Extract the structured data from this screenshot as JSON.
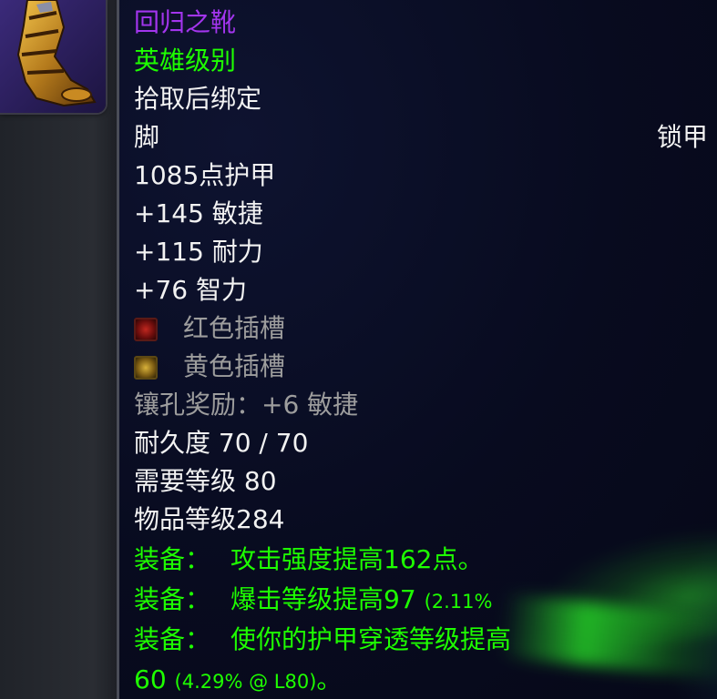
{
  "item": {
    "name": "回归之靴",
    "quality": "英雄级别",
    "binding": "拾取后绑定",
    "slot": "脚",
    "armor_type": "锁甲",
    "armor": "1085点护甲",
    "stats": [
      "+145 敏捷",
      "+115 耐力",
      "+76 智力"
    ],
    "sockets": [
      {
        "color": "red",
        "label": "红色插槽"
      },
      {
        "color": "yellow",
        "label": "黄色插槽"
      }
    ],
    "socket_bonus": "镶孔奖励：+6 敏捷",
    "durability": "耐久度 70 / 70",
    "required_level": "需要等级 80",
    "item_level": "物品等级284",
    "equip_effects": [
      {
        "prefix": "装备：",
        "text": "攻击强度提高162点。",
        "note": ""
      },
      {
        "prefix": "装备：",
        "text": "爆击等级提高97",
        "note": "(2.11%"
      },
      {
        "prefix": "装备：",
        "text": "使你的护甲穿透等级提高",
        "note": ""
      }
    ],
    "equip_continuation": {
      "value": "60",
      "note": "(4.29% @ L80)",
      "end": "。"
    }
  },
  "colors": {
    "epic_purple": "#a335ee",
    "green": "#1eff00",
    "gray": "#9d9d9d",
    "white": "#f2f2f2",
    "background": "#080b1f"
  },
  "icons": {
    "item_icon": "boot-icon",
    "socket_red": "red-socket-icon",
    "socket_yellow": "yellow-socket-icon"
  }
}
